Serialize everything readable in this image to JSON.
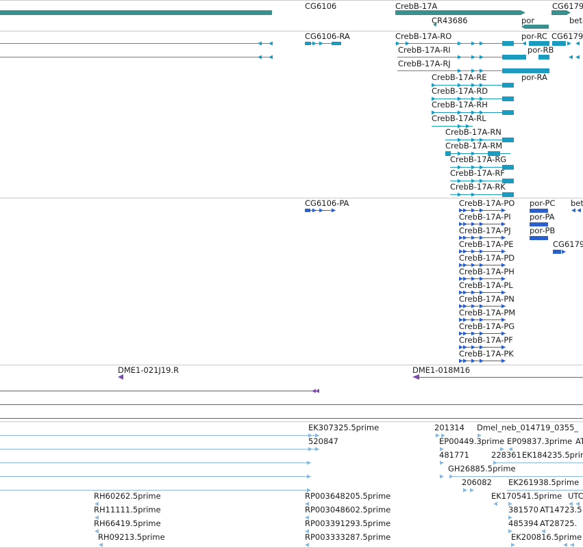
{
  "colors": {
    "gene": "#3a8f8f",
    "transcript": "#1a9bbf",
    "protein": "#2a5fcc",
    "clone": "#7a4aaa",
    "est": "#8ab8dc",
    "separator": "#c8c8c8",
    "text": "#1a1a1a"
  },
  "tracks": {
    "genes": {
      "labels": [
        "CG6106",
        "CrebB-17A",
        "CR43686",
        "por",
        "CG6179",
        "beta"
      ]
    },
    "transcripts": {
      "labels": [
        "CG6106-RA",
        "CrebB-17A-RO",
        "por-RC",
        "CG6179",
        "CrebB-17A-RI",
        "por-RB",
        "CrebB-17A-RJ",
        "CrebB-17A-RE",
        "por-RA",
        "CrebB-17A-RD",
        "CrebB-17A-RH",
        "CrebB-17A-RL",
        "CrebB-17A-RN",
        "CrebB-17A-RM",
        "CrebB-17A-RG",
        "CrebB-17A-RF",
        "CrebB-17A-RK"
      ]
    },
    "proteins": {
      "labels": [
        "CG6106-PA",
        "CrebB-17A-PO",
        "por-PC",
        "beta",
        "CrebB-17A-PI",
        "por-PA",
        "CrebB-17A-PJ",
        "por-PB",
        "CrebB-17A-PE",
        "CG6179",
        "CrebB-17A-PD",
        "CrebB-17A-PH",
        "CrebB-17A-PL",
        "CrebB-17A-PN",
        "CrebB-17A-PM",
        "CrebB-17A-PG",
        "CrebB-17A-PF",
        "CrebB-17A-PK"
      ]
    },
    "clones": {
      "labels": [
        "DME1-021J19.R",
        "DME1-018M16"
      ]
    },
    "ests": {
      "labels": [
        "EK307325.5prime",
        "201314",
        "Dmel_neb_014719_0355_",
        "520847",
        "EP00449.3prime",
        "EP09837.3prime",
        "AT",
        "481771",
        "228361",
        "EK184235.5prime",
        "GH26885.5prime",
        "206082",
        "EK261938.5prime",
        "RH60262.5prime",
        "RP003648205.5prime",
        "EK170541.5prime",
        "UTC",
        "RH11111.5prime",
        "RP003048602.5prime",
        "381570",
        "AT14723.5",
        "RH66419.5prime",
        "RP003391293.5prime",
        "485394",
        "AT28725.",
        "RH09213.5prime",
        "RP003333287.5prime",
        "EK200816.5prime"
      ]
    }
  }
}
